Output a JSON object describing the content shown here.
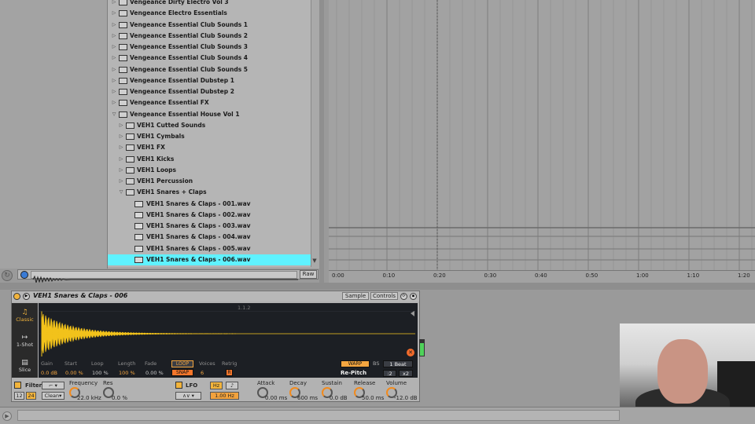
{
  "browser": {
    "items": [
      {
        "label": "Vengeance Dirty Electro Vol 3",
        "type": "folder",
        "depth": 0,
        "expanded": false
      },
      {
        "label": "Vengeance Electro Essentials",
        "type": "folder",
        "depth": 0,
        "expanded": false
      },
      {
        "label": "Vengeance Essential Club Sounds 1",
        "type": "folder",
        "depth": 0,
        "expanded": false
      },
      {
        "label": "Vengeance Essential Club Sounds 2",
        "type": "folder",
        "depth": 0,
        "expanded": false
      },
      {
        "label": "Vengeance Essential Club Sounds 3",
        "type": "folder",
        "depth": 0,
        "expanded": false
      },
      {
        "label": "Vengeance Essential Club Sounds 4",
        "type": "folder",
        "depth": 0,
        "expanded": false
      },
      {
        "label": "Vengeance Essential Club Sounds 5",
        "type": "folder",
        "depth": 0,
        "expanded": false
      },
      {
        "label": "Vengeance Essential Dubstep 1",
        "type": "folder",
        "depth": 0,
        "expanded": false
      },
      {
        "label": "Vengeance Essential Dubstep 2",
        "type": "folder",
        "depth": 0,
        "expanded": false
      },
      {
        "label": "Vengeance Essential FX",
        "type": "folder",
        "depth": 0,
        "expanded": false
      },
      {
        "label": "Vengeance Essential House Vol 1",
        "type": "folder",
        "depth": 0,
        "expanded": true
      },
      {
        "label": "VEH1 Cutted Sounds",
        "type": "folder",
        "depth": 1,
        "expanded": false
      },
      {
        "label": "VEH1 Cymbals",
        "type": "folder",
        "depth": 1,
        "expanded": false
      },
      {
        "label": "VEH1 FX",
        "type": "folder",
        "depth": 1,
        "expanded": false
      },
      {
        "label": "VEH1 Kicks",
        "type": "folder",
        "depth": 1,
        "expanded": false
      },
      {
        "label": "VEH1 Loops",
        "type": "folder",
        "depth": 1,
        "expanded": false
      },
      {
        "label": "VEH1 Percussion",
        "type": "folder",
        "depth": 1,
        "expanded": false
      },
      {
        "label": "VEH1 Snares + Claps",
        "type": "folder",
        "depth": 1,
        "expanded": true
      },
      {
        "label": "VEH1 Snares & Claps - 001.wav",
        "type": "file",
        "depth": 2
      },
      {
        "label": "VEH1 Snares & Claps - 002.wav",
        "type": "file",
        "depth": 2
      },
      {
        "label": "VEH1 Snares & Claps - 003.wav",
        "type": "file",
        "depth": 2
      },
      {
        "label": "VEH1 Snares & Claps - 004.wav",
        "type": "file",
        "depth": 2
      },
      {
        "label": "VEH1 Snares & Claps - 005.wav",
        "type": "file",
        "depth": 2
      },
      {
        "label": "VEH1 Snares & Claps - 006.wav",
        "type": "file",
        "depth": 2,
        "selected": true
      }
    ],
    "selected_color": "#5ff2ff",
    "raw_label": "Raw"
  },
  "timeline": {
    "ticks": [
      "0:00",
      "0:10",
      "0:20",
      "0:30",
      "0:40",
      "0:50",
      "1:00",
      "1:10",
      "1:20"
    ]
  },
  "device": {
    "title": "VEH1 Snares & Claps - 006",
    "tab_sample": "Sample",
    "tab_controls": "Controls",
    "modes": [
      {
        "label": "Classic",
        "icon": "headphones-icon",
        "active": true
      },
      {
        "label": "1-Shot",
        "icon": "arrow-right-icon",
        "active": false
      },
      {
        "label": "Slice",
        "icon": "slice-icon",
        "active": false
      }
    ],
    "marker": "1.1.2",
    "params": {
      "gain_label": "Gain",
      "gain_value": "0.0 dB",
      "start_label": "Start",
      "start_value": "0.00 %",
      "loop_label": "Loop",
      "loop_value": "100 %",
      "length_label": "Length",
      "length_value": "100 %",
      "fade_label": "Fade",
      "fade_value": "0.00 %",
      "loop_btn": "LOOP",
      "snap_btn": "SNAP",
      "voices_label": "Voices",
      "voices_value": "6",
      "retrig_label": "Retrig",
      "retrig_value": "R"
    },
    "warp": {
      "warp_btn": "WARP",
      "bs_label": "BS",
      "beat_value": "1 Beat",
      "mode_value": "Re-Pitch",
      "div_label": ":2",
      "mul_label": "x2"
    },
    "accent": "#f4a640",
    "waveform": {
      "type": "decaying_oscillation",
      "color": "#f2c21b"
    }
  },
  "controls": {
    "filter_label": "Filter",
    "filter_type": "Clean",
    "filter_12": "12",
    "filter_24": "24",
    "frequency_label": "Frequency",
    "frequency_value": "22.0 kHz",
    "res_label": "Res",
    "res_value": "0.0 %",
    "lfo_label": "LFO",
    "lfo_hz": "Hz",
    "lfo_note": "♪",
    "lfo_rate": "1.00 Hz",
    "attack_label": "Attack",
    "attack_value": "0.00 ms",
    "decay_label": "Decay",
    "decay_value": "600 ms",
    "sustain_label": "Sustain",
    "sustain_value": "0.0 dB",
    "release_label": "Release",
    "release_value": "50.0 ms",
    "volume_label": "Volume",
    "volume_value": "-12.0 dB"
  }
}
